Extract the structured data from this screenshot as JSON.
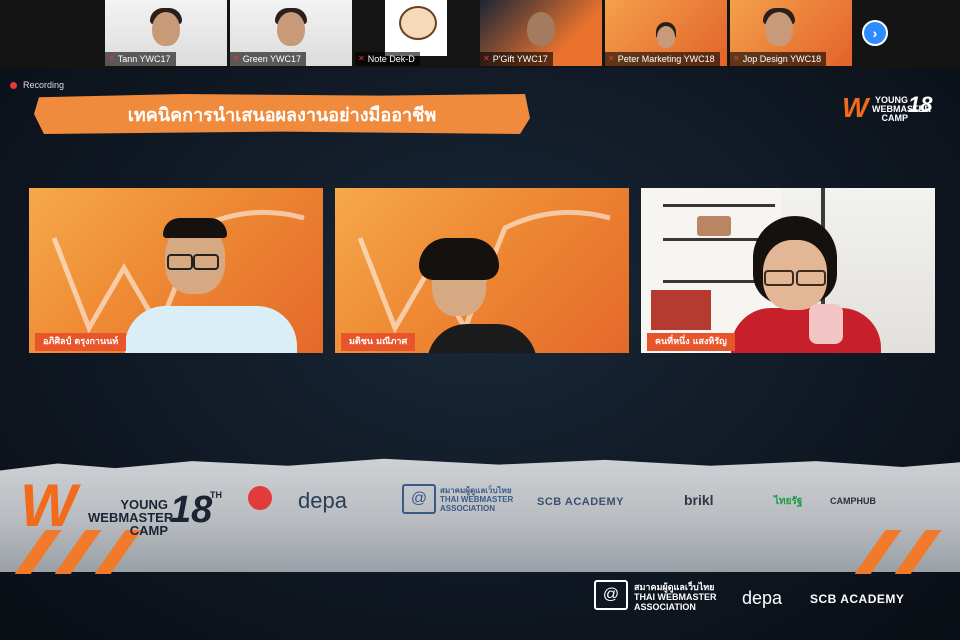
{
  "participants": [
    {
      "name": "Tann YWC17",
      "bg": "white"
    },
    {
      "name": "Green YWC17",
      "bg": "white"
    },
    {
      "name": "Note Dek-D",
      "bg": "cartoon"
    },
    {
      "name": "P'Gift YWC17",
      "bg": "dark"
    },
    {
      "name": "Peter Marketing YWC18",
      "bg": "orange"
    },
    {
      "name": "Jop Design YWC18",
      "bg": "orange"
    }
  ],
  "recording_label": "Recording",
  "title": "เทคนิคการนำเสนอผลงานอย่างมืออาชีพ",
  "event_logo": {
    "mark": "W",
    "line1": "YOUNG",
    "line2": "WEBMASTER",
    "line3": "CAMP",
    "number": "18",
    "suffix": "TH"
  },
  "speakers": [
    {
      "name": "อภิศิลป์ ตรุงกานนท์"
    },
    {
      "name": "มติชน มณีภาศ"
    },
    {
      "name": "คนที่หนึ่ง แสงหิรัญ"
    }
  ],
  "sponsors": {
    "top_row": [
      "depa",
      "สมาคมผู้ดูแลเว็บไทย",
      "THAI WEBMASTER",
      "ASSOCIATION",
      "SCB ACADEMY",
      "brikl",
      "ไทยรัฐ",
      "CAMPHUB"
    ],
    "bottom_row": [
      "สมาคมผู้ดูแลเว็บไทย",
      "THAI WEBMASTER",
      "ASSOCIATION",
      "depa",
      "SCB ACADEMY"
    ]
  },
  "colors": {
    "accent": "#f26b1d",
    "zoom_blue": "#2d8cff",
    "recording": "#e23b3b"
  }
}
